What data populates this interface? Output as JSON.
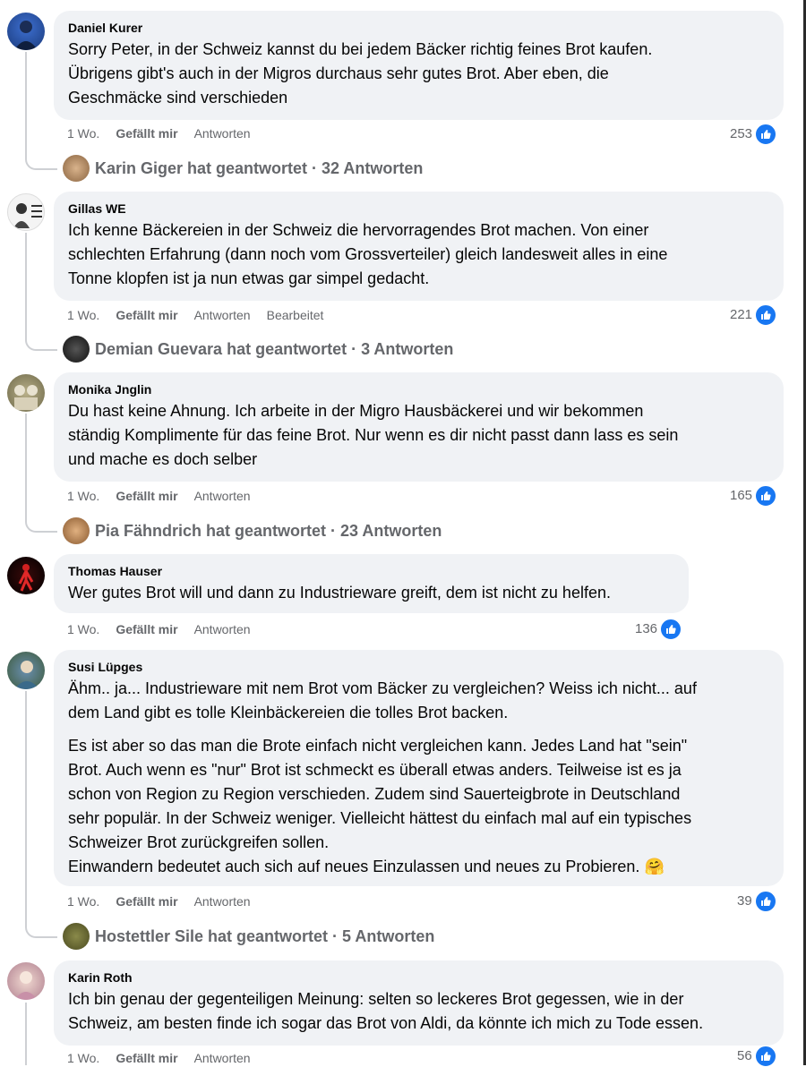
{
  "actions": {
    "time": "1 Wo.",
    "like": "Gefällt mir",
    "reply": "Antworten",
    "edited": "Bearbeitet"
  },
  "comments": [
    {
      "author": "Daniel Kurer",
      "text": "Sorry Peter, in der Schweiz kannst du bei jedem Bäcker richtig feines Brot kaufen.\nÜbrigens gibt's auch in der Migros durchaus sehr gutes Brot. Aber eben, die\nGeschmäcke sind verschieden",
      "likes": "253",
      "replies": "Karin Giger hat geantwortet · 32 Antworten"
    },
    {
      "author": "Gillas WE",
      "text": "Ich kenne Bäckereien in der Schweiz die hervorragendes Brot machen. Von einer\nschlechten Erfahrung (dann noch vom Grossverteiler) gleich landesweit alles in eine\nTonne klopfen ist ja nun etwas gar simpel gedacht.",
      "likes": "221",
      "replies": "Demian Guevara hat geantwortet · 3 Antworten"
    },
    {
      "author": "Monika Jnglin",
      "text": "Du hast keine Ahnung. Ich arbeite in der Migro Hausbäckerei und wir bekommen\nständig Komplimente für das feine Brot. Nur wenn es dir nicht passt dann lass es sein\nund mache es doch selber",
      "likes": "165",
      "replies": "Pia Fähndrich hat geantwortet · 23 Antworten"
    },
    {
      "author": "Thomas Hauser",
      "text": "Wer gutes Brot will und dann zu Industrieware greift, dem ist nicht zu helfen.",
      "likes": "136"
    },
    {
      "author": "Susi Lüpges",
      "text": "Ähm.. ja... Industrieware mit nem Brot vom Bäcker zu vergleichen? Weiss ich nicht... auf\ndem Land gibt es tolle Kleinbäckereien die tolles Brot backen.",
      "text2": "Es ist aber so das man die Brote einfach nicht vergleichen kann. Jedes Land hat \"sein\"\nBrot. Auch wenn es \"nur\" Brot ist schmeckt es überall etwas anders. Teilweise ist es ja\nschon von Region zu Region verschieden. Zudem sind Sauerteigbrote in Deutschland\nsehr populär. In der Schweiz weniger. Vielleicht hättest du einfach mal auf ein typisches\nSchweizer Brot zurückgreifen sollen.\nEinwandern bedeutet auch sich auf neues Einzulassen und neues zu Probieren. 🤗",
      "likes": "39",
      "replies": "Hostettler Sile hat geantwortet · 5 Antworten"
    },
    {
      "author": "Karin Roth",
      "text": "Ich bin genau der gegenteiligen Meinung: selten so leckeres Brot gegessen, wie in der\nSchweiz, am besten finde ich sogar das Brot von Aldi, da könnte ich mich zu Tode essen.",
      "likes": "56"
    }
  ],
  "colors": {
    "bubble": "#f0f2f5",
    "meta": "#65676b",
    "like_blue": "#1877f2",
    "thread": "#ced0d4"
  },
  "icons": {
    "like": "thumbs-up-icon"
  }
}
